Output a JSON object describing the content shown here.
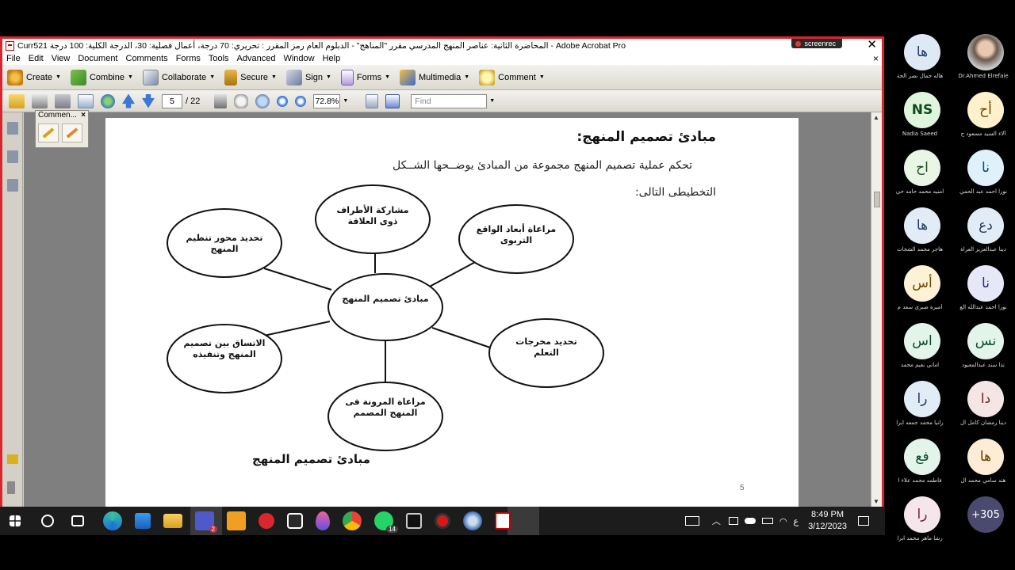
{
  "window": {
    "title": "Curr521 المحاضرة الثانية: عناصر المنهج المدرسي مقرر \"المناهج\" - الدبلوم العام رمز المقرر : تحريري: 70 درجة، أعمال فصلية: 30، الدرجة الكلية: 100 درجة - Adobe Acrobat Pro",
    "screenrec_label": "screenrec",
    "close_glyph": "✕"
  },
  "menu": {
    "items": [
      "File",
      "Edit",
      "View",
      "Document",
      "Comments",
      "Forms",
      "Tools",
      "Advanced",
      "Window",
      "Help"
    ],
    "close_glyph": "×"
  },
  "toolbar1": {
    "create": "Create",
    "combine": "Combine",
    "collaborate": "Collaborate",
    "secure": "Secure",
    "sign": "Sign",
    "forms": "Forms",
    "multimedia": "Multimedia",
    "comment": "Comment"
  },
  "toolbar2": {
    "current_page": "5",
    "total_pages": "/ 22",
    "zoom": "72.8%",
    "find_placeholder": "Find"
  },
  "comment_panel": {
    "title": "Commen...",
    "close_glyph": "×"
  },
  "document": {
    "heading": "مبادئ تصميم المنهج:",
    "paragraph_line1": "تحكم عملية تصميم المنهج مجموعة من المبادئ يوضــحها الشــكل",
    "paragraph_line2": "التخطيطى التالى:",
    "page_number": "5",
    "diagram": {
      "center": "مبادئ تصميم المنهج",
      "nodes": [
        "مشاركة الأطراف ذوى العلاقة",
        "مراعاة أبعاد الواقع التربوى",
        "تحديد مخرجات التعلم",
        "مراعاة المرونة فى المنهج المصمم",
        "الاتساق بين تصميم المنهج وتنفيذه",
        "تحديد محور تنظيم المنهج"
      ],
      "caption": "مبادئ تصميم المنهج"
    }
  },
  "taskbar": {
    "teams_badge": "2",
    "whatsapp_badge": "14",
    "lang": "ع",
    "time": "8:49 PM",
    "date": "3/12/2023"
  },
  "participants": [
    {
      "initials": "",
      "name": "Dr.Ahmed Elrefaie"
    },
    {
      "initials": "ها",
      "name": "هاله جمال نصر الخة"
    },
    {
      "initials": "أح",
      "name": "آلاء السيد مسعود ح"
    },
    {
      "initials": "NS",
      "name": "Nadia Saeed"
    },
    {
      "initials": "نا",
      "name": "نورا احمد عبد الحمي"
    },
    {
      "initials": "اح",
      "name": "امنيه محمد حامد حي"
    },
    {
      "initials": "دع",
      "name": "دينا عبدالعزيز العراة"
    },
    {
      "initials": "ها",
      "name": "هاجر محمد الشحات"
    },
    {
      "initials": "نا",
      "name": "نورا احمد عبدالله الع"
    },
    {
      "initials": "أس",
      "name": "أميرة صبري سعد م"
    },
    {
      "initials": "نس",
      "name": "نذا سند عبدالمعبود"
    },
    {
      "initials": "اس",
      "name": "اماني نعيم محمد"
    },
    {
      "initials": "دا",
      "name": "دينا رمضان كامل ال"
    },
    {
      "initials": "را",
      "name": "رانيا محمد جمعه ابرا"
    },
    {
      "initials": "ها",
      "name": "هند سامي محمد ال"
    },
    {
      "initials": "فع",
      "name": "فاطمه محمد علاء ا"
    },
    {
      "initials": "را",
      "name": "رشا ماهر محمد ابرا"
    },
    {
      "initials": "+305",
      "name": ""
    }
  ]
}
